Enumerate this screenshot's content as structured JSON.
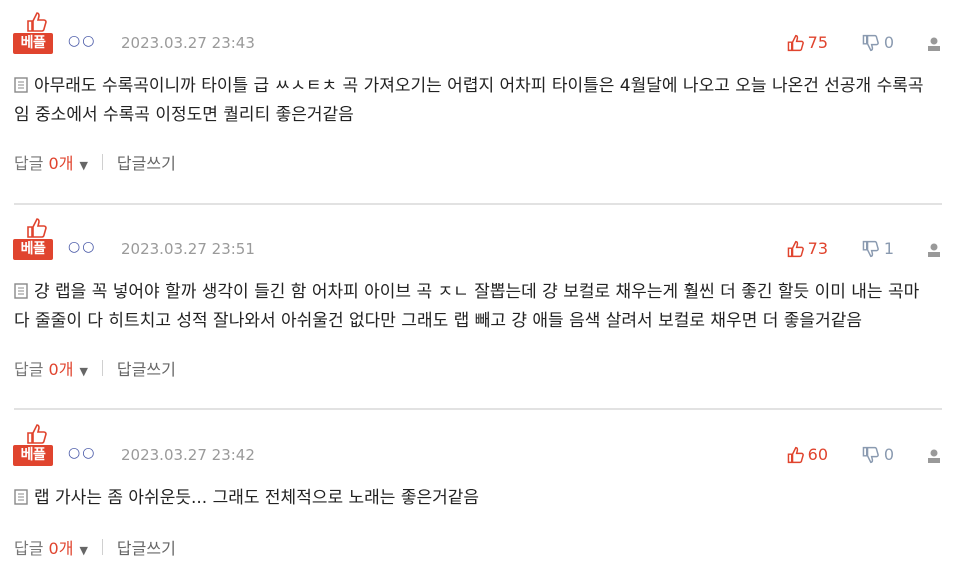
{
  "comments": [
    {
      "badge": "베플",
      "nickname": "○○",
      "date": "2023.03.27 23:43",
      "likes": "75",
      "dislikes": "0",
      "text": "아무래도 수록곡이니까 타이틀 급 ㅆㅅㅌㅊ 곡 가져오기는 어렵지 어차피 타이틀은 4월달에 나오고 오늘 나온건 선공개 수록곡임 중소에서 수록곡 이정도면 퀄리티 좋은거같음",
      "reply_label": "답글",
      "reply_count": "0개",
      "write_reply": "답글쓰기"
    },
    {
      "badge": "베플",
      "nickname": "○○",
      "date": "2023.03.27 23:51",
      "likes": "73",
      "dislikes": "1",
      "text": "걍 랩을 꼭 넣어야 할까 생각이 들긴 함 어차피 아이브 곡 ㅈㄴ 잘뽑는데 걍 보컬로 채우는게 훨씬 더 좋긴 할듯 이미 내는 곡마다 줄줄이 다 히트치고 성적 잘나와서 아쉬울건 없다만 그래도 랩 빼고 걍 애들 음색 살려서 보컬로 채우면 더 좋을거같음",
      "reply_label": "답글",
      "reply_count": "0개",
      "write_reply": "답글쓰기"
    },
    {
      "badge": "베플",
      "nickname": "○○",
      "date": "2023.03.27 23:42",
      "likes": "60",
      "dislikes": "0",
      "text": "랩 가사는 좀 아쉬운듯... 그래도 전체적으로 노래는 좋은거같음",
      "reply_label": "답글",
      "reply_count": "0개",
      "write_reply": "답글쓰기"
    }
  ],
  "colors": {
    "accent": "#e0442e",
    "nickname": "#4a5aa8",
    "muted": "#9a9a9a"
  },
  "icons": [
    "thumbs-up-icon",
    "thumbs-down-icon",
    "document-icon",
    "user-icon",
    "caret-down-icon"
  ]
}
